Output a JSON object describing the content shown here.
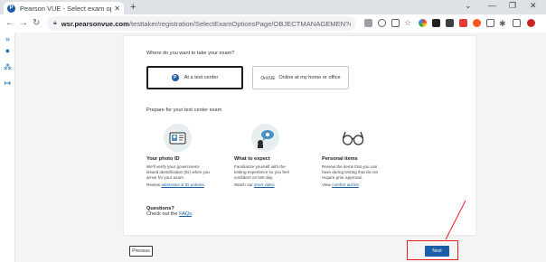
{
  "browser": {
    "tab_title": "Pearson VUE - Select exam op",
    "tab_close": "✕",
    "new_tab": "+",
    "url_host": "wsr.pearsonvue.com",
    "url_path": "/testtaker/registration/SelectExamOptionsPage/OBJECTMANAGEMEN?conver...",
    "window_controls": {
      "minimize": "—",
      "maximize": "❐",
      "close": "✕",
      "expand": "⌄"
    }
  },
  "exam_location": {
    "question": "Where do you want to take your exam?",
    "options": [
      {
        "label": "At a test center",
        "selected": true
      },
      {
        "logo": "OnVUE",
        "label": "Online at my home or office",
        "selected": false
      }
    ]
  },
  "prepare": {
    "heading": "Prepare for your test center exam",
    "items": [
      {
        "title": "Your photo ID",
        "text": "We'll verify your government-issued identification (ID) when you arrive for your exam.",
        "link_prefix": "Review",
        "link": "admission & ID policies",
        "link_suffix": "."
      },
      {
        "title": "What to expect",
        "text": "Familiarize yourself with the testing experience so you feel confident on test day.",
        "link_prefix": "Watch our",
        "link": "short video",
        "link_suffix": "."
      },
      {
        "title": "Personal items",
        "text": "Review the items that you can have during testing that do not require prior approval.",
        "link_prefix": "View",
        "link": "comfort aid list",
        "link_suffix": "."
      }
    ]
  },
  "questions": {
    "title": "Questions?",
    "prefix": "Check out the",
    "link": "FAQs",
    "suffix": "."
  },
  "buttons": {
    "previous": "Previous",
    "next": "Next"
  },
  "colors": {
    "brand": "#1a5ea8",
    "annotation": "#e41e1e"
  }
}
